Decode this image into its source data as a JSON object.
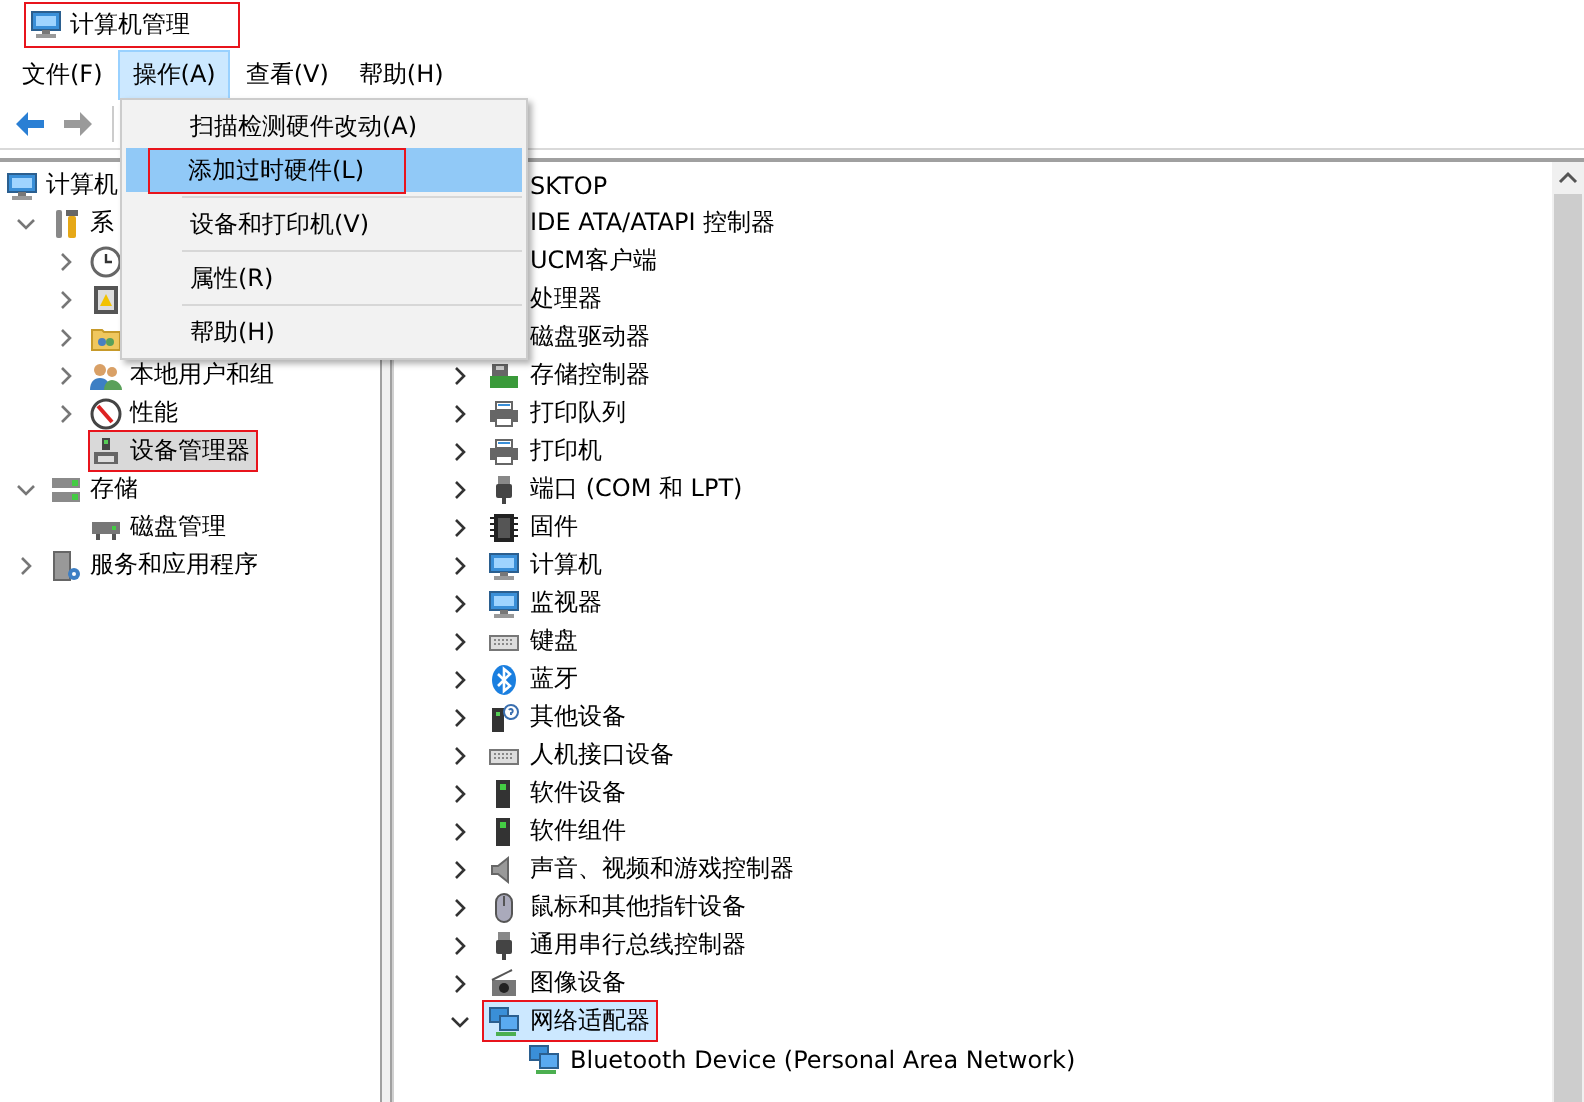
{
  "window": {
    "title": "计算机管理",
    "kind": "computer",
    "annotated": true
  },
  "menubar": [
    {
      "label": "文件(F)",
      "selected": false
    },
    {
      "label": "操作(A)",
      "selected": true
    },
    {
      "label": "查看(V)",
      "selected": false
    },
    {
      "label": "帮助(H)",
      "selected": false
    }
  ],
  "toolbar": [
    {
      "kind": "back",
      "disabled": false
    },
    {
      "kind": "forward",
      "disabled": true
    }
  ],
  "dropdown_menu": {
    "items": [
      {
        "kind": "item",
        "label": "扫描检测硬件改动(A)",
        "selected": false,
        "annotated": false
      },
      {
        "kind": "item",
        "label": "添加过时硬件(L)",
        "selected": true,
        "annotated": true
      },
      {
        "kind": "separator"
      },
      {
        "kind": "item",
        "label": "设备和打印机(V)",
        "selected": false,
        "annotated": false
      },
      {
        "kind": "separator"
      },
      {
        "kind": "item",
        "label": "属性(R)",
        "selected": false,
        "annotated": false
      },
      {
        "kind": "separator"
      },
      {
        "kind": "item",
        "label": "帮助(H)",
        "selected": false,
        "annotated": false
      }
    ]
  },
  "left_tree": [
    {
      "text": "计算机",
      "kind": "computer",
      "selected": false,
      "children": [
        {
          "text": "系",
          "kind": "tools",
          "expanded": true,
          "selected": false,
          "children": [
            {
              "kind": "clock",
              "expanded": false,
              "selected": false
            },
            {
              "kind": "book",
              "expanded": false,
              "selected": false
            },
            {
              "kind": "shared-folder",
              "expanded": false,
              "selected": false
            },
            {
              "text": "本地用户和组",
              "kind": "users",
              "expanded": false,
              "selected": false
            },
            {
              "text": "性能",
              "kind": "gauge",
              "expanded": false,
              "selected": false
            },
            {
              "text": "设备管理器",
              "kind": "device-manager",
              "selected": true,
              "annotated": true
            }
          ]
        },
        {
          "text": "存储",
          "kind": "storage",
          "expanded": true,
          "selected": false,
          "children": [
            {
              "text": "磁盘管理",
              "kind": "disk",
              "selected": false
            }
          ]
        },
        {
          "text": "服务和应用程序",
          "kind": "services",
          "expanded": false,
          "selected": false
        }
      ]
    }
  ],
  "device_tree": [
    {
      "text": "SKTOP",
      "selected": false,
      "children": [
        {
          "text": "IDE ATA/ATAPI 控制器",
          "selected": false
        },
        {
          "text": "UCM客户端",
          "selected": false
        },
        {
          "text": "处理器",
          "selected": false
        },
        {
          "text": "磁盘驱动器",
          "selected": false
        },
        {
          "text": "存储控制器",
          "kind": "storage-controller",
          "expanded": false,
          "selected": false
        },
        {
          "text": "打印队列",
          "kind": "printer",
          "expanded": false,
          "selected": false
        },
        {
          "text": "打印机",
          "kind": "printer",
          "expanded": false,
          "selected": false
        },
        {
          "text": "端口 (COM 和 LPT)",
          "kind": "port",
          "expanded": false,
          "selected": false
        },
        {
          "text": "固件",
          "kind": "chip",
          "expanded": false,
          "selected": false
        },
        {
          "text": "计算机",
          "kind": "computer",
          "expanded": false,
          "selected": false
        },
        {
          "text": "监视器",
          "kind": "computer",
          "expanded": false,
          "selected": false
        },
        {
          "text": "键盘",
          "kind": "keyboard",
          "expanded": false,
          "selected": false
        },
        {
          "text": "蓝牙",
          "kind": "bluetooth",
          "expanded": false,
          "selected": false
        },
        {
          "text": "其他设备",
          "kind": "other",
          "expanded": false,
          "selected": false
        },
        {
          "text": "人机接口设备",
          "kind": "keyboard",
          "expanded": false,
          "selected": false
        },
        {
          "text": "软件设备",
          "kind": "tower",
          "expanded": false,
          "selected": false
        },
        {
          "text": "软件组件",
          "kind": "tower",
          "expanded": false,
          "selected": false
        },
        {
          "text": "声音、视频和游戏控制器",
          "kind": "speaker",
          "expanded": false,
          "selected": false
        },
        {
          "text": "鼠标和其他指针设备",
          "kind": "mouse",
          "expanded": false,
          "selected": false
        },
        {
          "text": "通用串行总线控制器",
          "kind": "port",
          "expanded": false,
          "selected": false
        },
        {
          "text": "图像设备",
          "kind": "camera",
          "expanded": false,
          "selected": false
        },
        {
          "text": "网络适配器",
          "kind": "network",
          "expanded": true,
          "selected": true,
          "annotated": true,
          "children": [
            {
              "text": "Bluetooth Device (Personal Area Network)",
              "kind": "network",
              "selected": false
            }
          ]
        }
      ]
    }
  ]
}
